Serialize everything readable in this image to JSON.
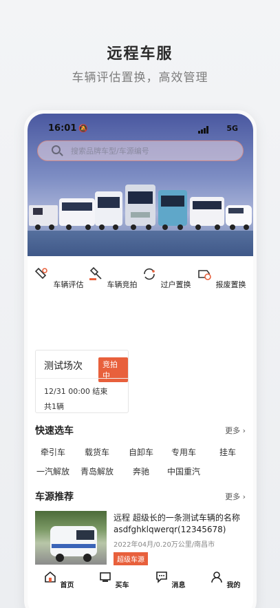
{
  "hero": {
    "title": "远程车服",
    "subtitle": "车辆评估置换，高效管理"
  },
  "status": {
    "time": "16:01",
    "network": "5G"
  },
  "search": {
    "placeholder": "搜索品牌车型/车源编号"
  },
  "services": [
    {
      "label": "车辆评估",
      "icon": "evaluate-icon"
    },
    {
      "label": "车辆竞拍",
      "icon": "auction-icon"
    },
    {
      "label": "过户置换",
      "icon": "transfer-icon"
    },
    {
      "label": "报废置换",
      "icon": "scrap-icon"
    }
  ],
  "session": {
    "name": "测试场次",
    "badge": "竞拍中",
    "time": "12/31 00:00 结束",
    "count": "共1辆"
  },
  "quick": {
    "title": "快速选车",
    "more": "更多",
    "row1": [
      "牵引车",
      "载货车",
      "自卸车",
      "专用车",
      "挂车"
    ],
    "row2": [
      "一汽解放",
      "青岛解放",
      "奔驰",
      "中国重汽"
    ]
  },
  "recommend": {
    "title": "车源推荐",
    "more": "更多",
    "item": {
      "title": "远程 超级长的一条测试车辆的名称asdfghklqwerqr(12345678)",
      "meta": "2022年04月/0.20万公里/南昌市",
      "tag": "超级车源"
    }
  },
  "tabs": [
    {
      "label": "首页",
      "icon": "home-icon"
    },
    {
      "label": "买车",
      "icon": "buy-car-icon"
    },
    {
      "label": "消息",
      "icon": "message-icon"
    },
    {
      "label": "我的",
      "icon": "profile-icon"
    }
  ],
  "colors": {
    "accent": "#e8603c",
    "banner": "#6a7fbe"
  }
}
